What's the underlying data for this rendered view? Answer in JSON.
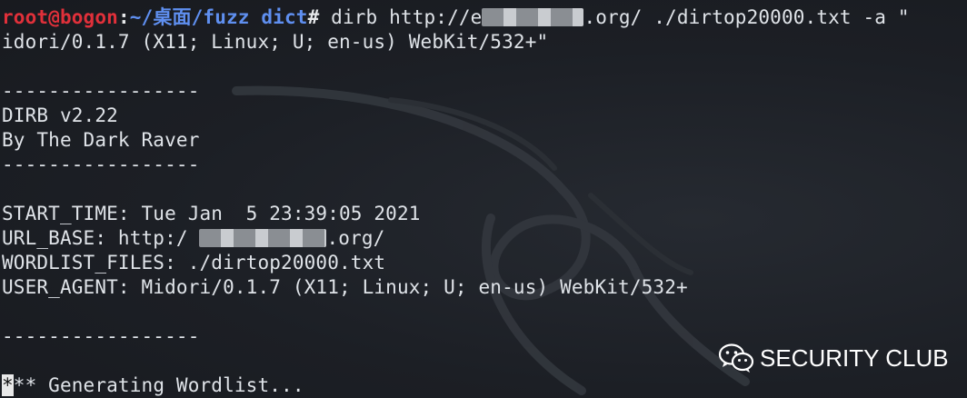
{
  "terminal": {
    "prompt": {
      "user_host": "root@bogon",
      "colon": ":",
      "path": "~/桌面/fuzz dict",
      "hash": "#"
    },
    "command_part1": " dirb http://e",
    "command_part2": ".org/ ./dirtop20000.txt -a \"",
    "line2": "idori/0.1.7 (X11; Linux; U; en-us) WebKit/532+\"",
    "separator": "-----------------",
    "banner_title": "DIRB v2.22",
    "banner_author": "By The Dark Raver",
    "start_time": "START_TIME: Tue Jan  5 23:39:05 2021",
    "url_base_prefix": "URL_BASE: http:/ ",
    "url_base_suffix": ".org/",
    "wordlist_files": "WORDLIST_FILES: ./dirtop20000.txt",
    "user_agent": "USER_AGENT: Midori/0.1.7 (X11; Linux; U; en-us) WebKit/532+",
    "cursor_char": "*",
    "generating": "** Generating Wordlist..."
  },
  "watermark": {
    "text": "SECURITY CLUB",
    "icon": "wechat-icon"
  },
  "colors": {
    "background": "#1b1e24",
    "text": "#dfe3e8",
    "user_host": "#e0303a",
    "path": "#5f8ff0"
  }
}
